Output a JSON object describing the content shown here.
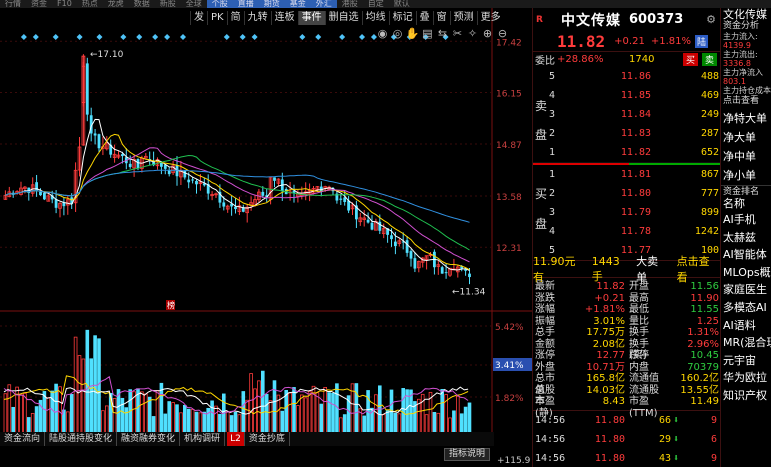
{
  "top_menu": [
    "行情",
    "资金",
    "F10",
    "热点",
    "龙虎",
    "数据",
    "新股",
    "全球",
    "个股",
    "直播",
    "期货",
    "基金",
    "外汇",
    "港股",
    "自定",
    "默认"
  ],
  "chart_bar": {
    "items": [
      "发",
      "PK",
      "简",
      "九转",
      "连板",
      "事件",
      "删自选",
      "均线",
      "标记",
      "叠",
      "窗",
      "预测",
      "更多"
    ],
    "active": "事件"
  },
  "tool_icons": [
    "eye-icon",
    "target-icon",
    "hand-icon",
    "chart-icon",
    "pair-icon",
    "cut-icon",
    "mark-icon",
    "zoom-in-icon",
    "zoom-out-icon"
  ],
  "chart_labels": {
    "peak": "17.10",
    "low": "11.34",
    "tag": "榜"
  },
  "price_axis": [
    "17.42",
    "16.15",
    "14.87",
    "13.58",
    "12.31"
  ],
  "vol_axis": [
    "5.42%",
    "3.41%",
    "1.82%"
  ],
  "bottom_tabs": [
    "资金流向",
    "陆股通持股变化",
    "融资融券变化",
    "机构调研",
    "L2",
    "资金抄底"
  ],
  "indicator_btn": "指标说明",
  "bottom_num": "+115.9",
  "quote": {
    "r_tag": "R",
    "name": "中文传媒",
    "code": "600373",
    "price": "11.82",
    "change": "+0.21",
    "pct": "+1.81%",
    "badge": "陆",
    "wb_label": "委比",
    "wb_val": "+28.86%",
    "wb_diff": "1740",
    "buy_label": "买",
    "sell_label": "卖",
    "sell_side": "卖盘",
    "buy_side": "买盘",
    "asks": [
      {
        "lv": "5",
        "price": "11.86",
        "vol": "488"
      },
      {
        "lv": "4",
        "price": "11.85",
        "vol": "469"
      },
      {
        "lv": "3",
        "price": "11.84",
        "vol": "249"
      },
      {
        "lv": "2",
        "price": "11.83",
        "vol": "287"
      },
      {
        "lv": "1",
        "price": "11.82",
        "vol": "652"
      }
    ],
    "bids": [
      {
        "lv": "1",
        "price": "11.81",
        "vol": "867"
      },
      {
        "lv": "2",
        "price": "11.80",
        "vol": "777"
      },
      {
        "lv": "3",
        "price": "11.79",
        "vol": "899"
      },
      {
        "lv": "4",
        "price": "11.78",
        "vol": "1242"
      },
      {
        "lv": "5",
        "price": "11.77",
        "vol": "100"
      }
    ],
    "big_order": {
      "price": "11.90元有",
      "vol": "1443手",
      "label": "大卖单",
      "link": "点击查看"
    },
    "stats": [
      [
        "最新",
        "11.82",
        "开盘",
        "11.56"
      ],
      [
        "涨跌",
        "+0.21",
        "最高",
        "11.90"
      ],
      [
        "涨幅",
        "+1.81%",
        "最低",
        "11.55"
      ],
      [
        "振幅",
        "3.01%",
        "量比",
        "1.25"
      ],
      [
        "总手",
        "17.75万",
        "换手",
        "1.31%"
      ],
      [
        "金额",
        "2.08亿",
        "换手(实)",
        "2.96%"
      ],
      [
        "涨停",
        "12.77",
        "跌停",
        "10.45"
      ],
      [
        "外盘",
        "10.71万",
        "内盘",
        "70379"
      ],
      [
        "总市值",
        "165.8亿",
        "流通值",
        "160.2亿"
      ],
      [
        "总股本",
        "14.03亿",
        "流通股",
        "13.55亿"
      ],
      [
        "市盈(静)",
        "8.43",
        "市盈(TTM)",
        "11.49"
      ]
    ],
    "ticks": [
      {
        "t": "14:56",
        "p": "11.80",
        "v": "66",
        "n": "9"
      },
      {
        "t": "14:56",
        "p": "11.80",
        "v": "29",
        "n": "6"
      },
      {
        "t": "14:56",
        "p": "11.80",
        "v": "43",
        "n": "9"
      }
    ]
  },
  "side_panel": {
    "title": "文化传媒",
    "subtitle": "资金分析",
    "flow": [
      {
        "l": "主力流入:",
        "v": "4139.9"
      },
      {
        "l": "主力流出:",
        "v": "3336.8"
      },
      {
        "l": "主力净流入",
        "v": "803.1"
      },
      {
        "l": "主力持仓成本",
        "v": ""
      }
    ],
    "link": "点击查看",
    "inflow": [
      "净特大单",
      "净大单",
      "净中单",
      "净小单"
    ],
    "rank_label": "资金排名",
    "rank_head": "名称",
    "concepts": [
      "AI手机",
      "太赫兹",
      "AI智能体",
      "MLOps概念",
      "家庭医生",
      "多模态AI",
      "AI语料",
      "MR(混合现实)",
      "元宇宙",
      "华为欧拉",
      "知识产权"
    ]
  }
}
